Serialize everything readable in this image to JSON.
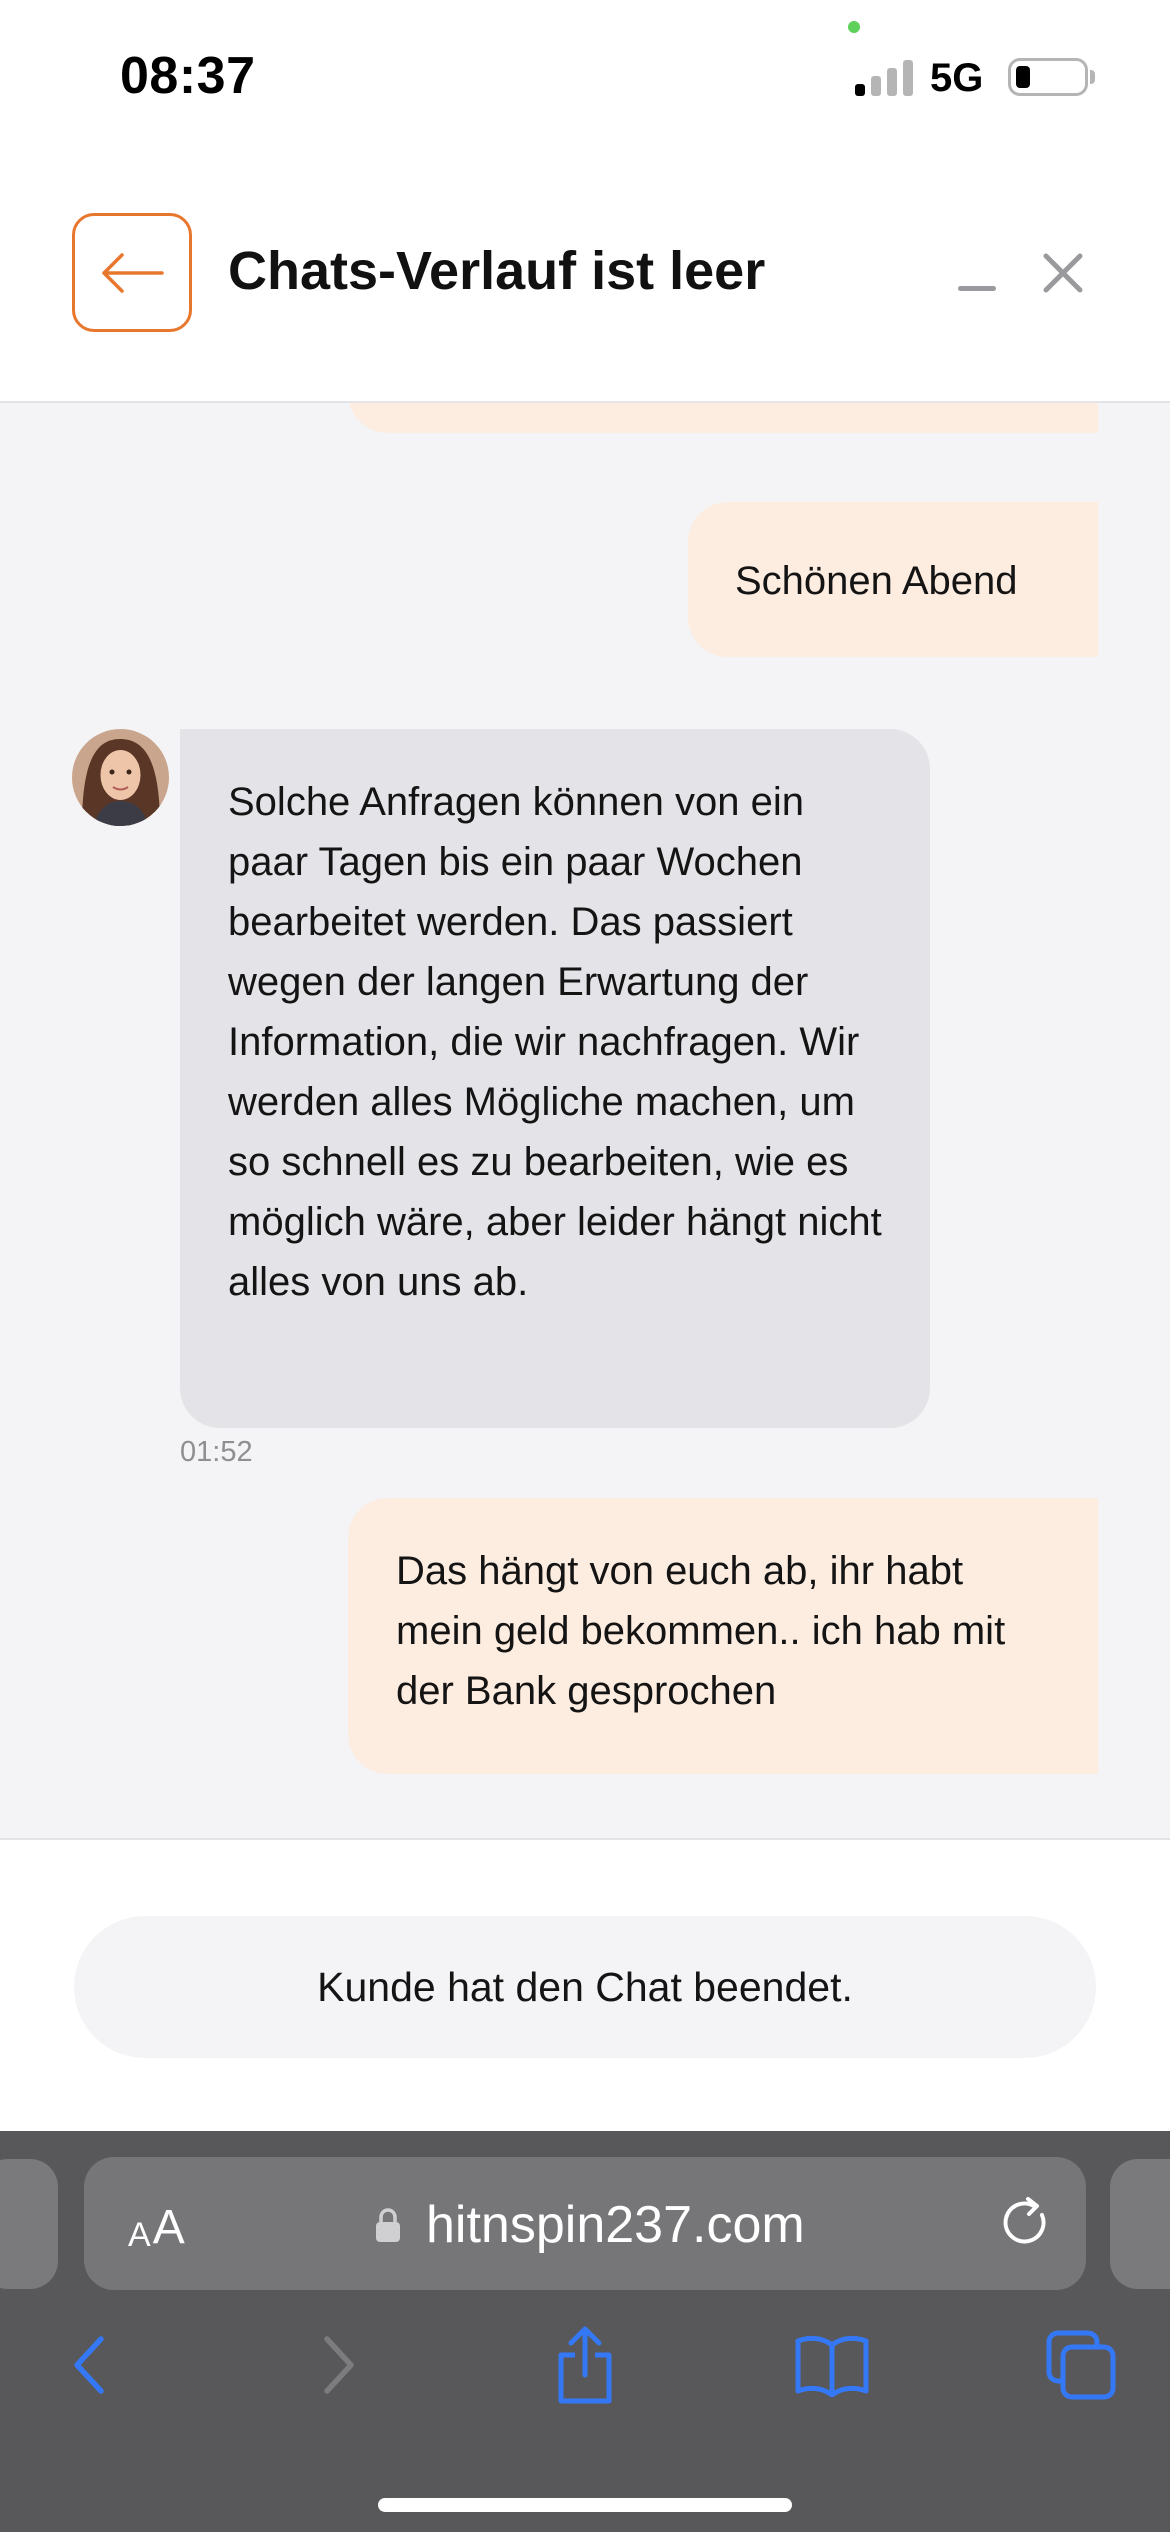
{
  "status_bar": {
    "time": "08:37",
    "network": "5G"
  },
  "header": {
    "title": "Chats-Verlauf ist leer"
  },
  "messages": [
    {
      "sender": "user",
      "text": "Schönen Abend"
    },
    {
      "sender": "agent",
      "text": "Solche Anfragen können von ein paar Tagen bis ein paar Wochen bearbeitet werden. Das passiert wegen der langen Erwartung der Information, die wir nachfragen. Wir werden alles Mögliche machen, um so schnell es zu bearbeiten, wie es möglich wäre, aber leider hängt nicht alles von uns ab.",
      "time": "01:52"
    },
    {
      "sender": "user",
      "text": "Das hängt von euch ab, ihr habt mein geld bekommen.. ich hab mit der Bank gesprochen"
    }
  ],
  "chat_status": "Kunde hat den Chat beendet.",
  "browser": {
    "aa_small": "A",
    "aa_big": "A",
    "url": "hitnspin237.com"
  },
  "colors": {
    "accent": "#e8772e",
    "user_bubble": "#fdece0",
    "agent_bubble": "#e4e4e8",
    "browser_tint": "#3478f6"
  }
}
